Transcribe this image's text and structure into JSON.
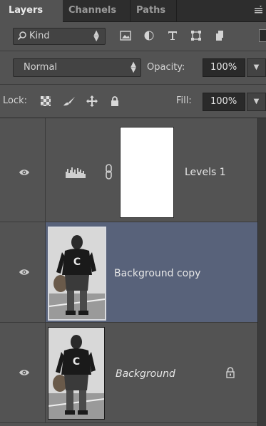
{
  "tabs": [
    {
      "label": "Layers",
      "active": true
    },
    {
      "label": "Channels",
      "active": false
    },
    {
      "label": "Paths",
      "active": false
    }
  ],
  "filter": {
    "kind_label": "Kind",
    "icons": [
      "pixel-filter-icon",
      "adjustment-filter-icon",
      "type-filter-icon",
      "shape-filter-icon",
      "smart-object-filter-icon"
    ]
  },
  "blend": {
    "mode": "Normal",
    "opacity_label": "Opacity:",
    "opacity_value": "100%"
  },
  "lock": {
    "label": "Lock:",
    "fill_label": "Fill:",
    "fill_value": "100%"
  },
  "layers": [
    {
      "name": "Levels 1",
      "type": "adjustment",
      "visible": true,
      "selected": false
    },
    {
      "name": "Background copy",
      "type": "pixel",
      "visible": true,
      "selected": true
    },
    {
      "name": "Background",
      "type": "pixel",
      "visible": true,
      "selected": false,
      "locked": true
    }
  ],
  "colors": {
    "panel_bg": "#535353",
    "selected_layer": "#58627a",
    "tab_bar": "#2d2d2d"
  }
}
